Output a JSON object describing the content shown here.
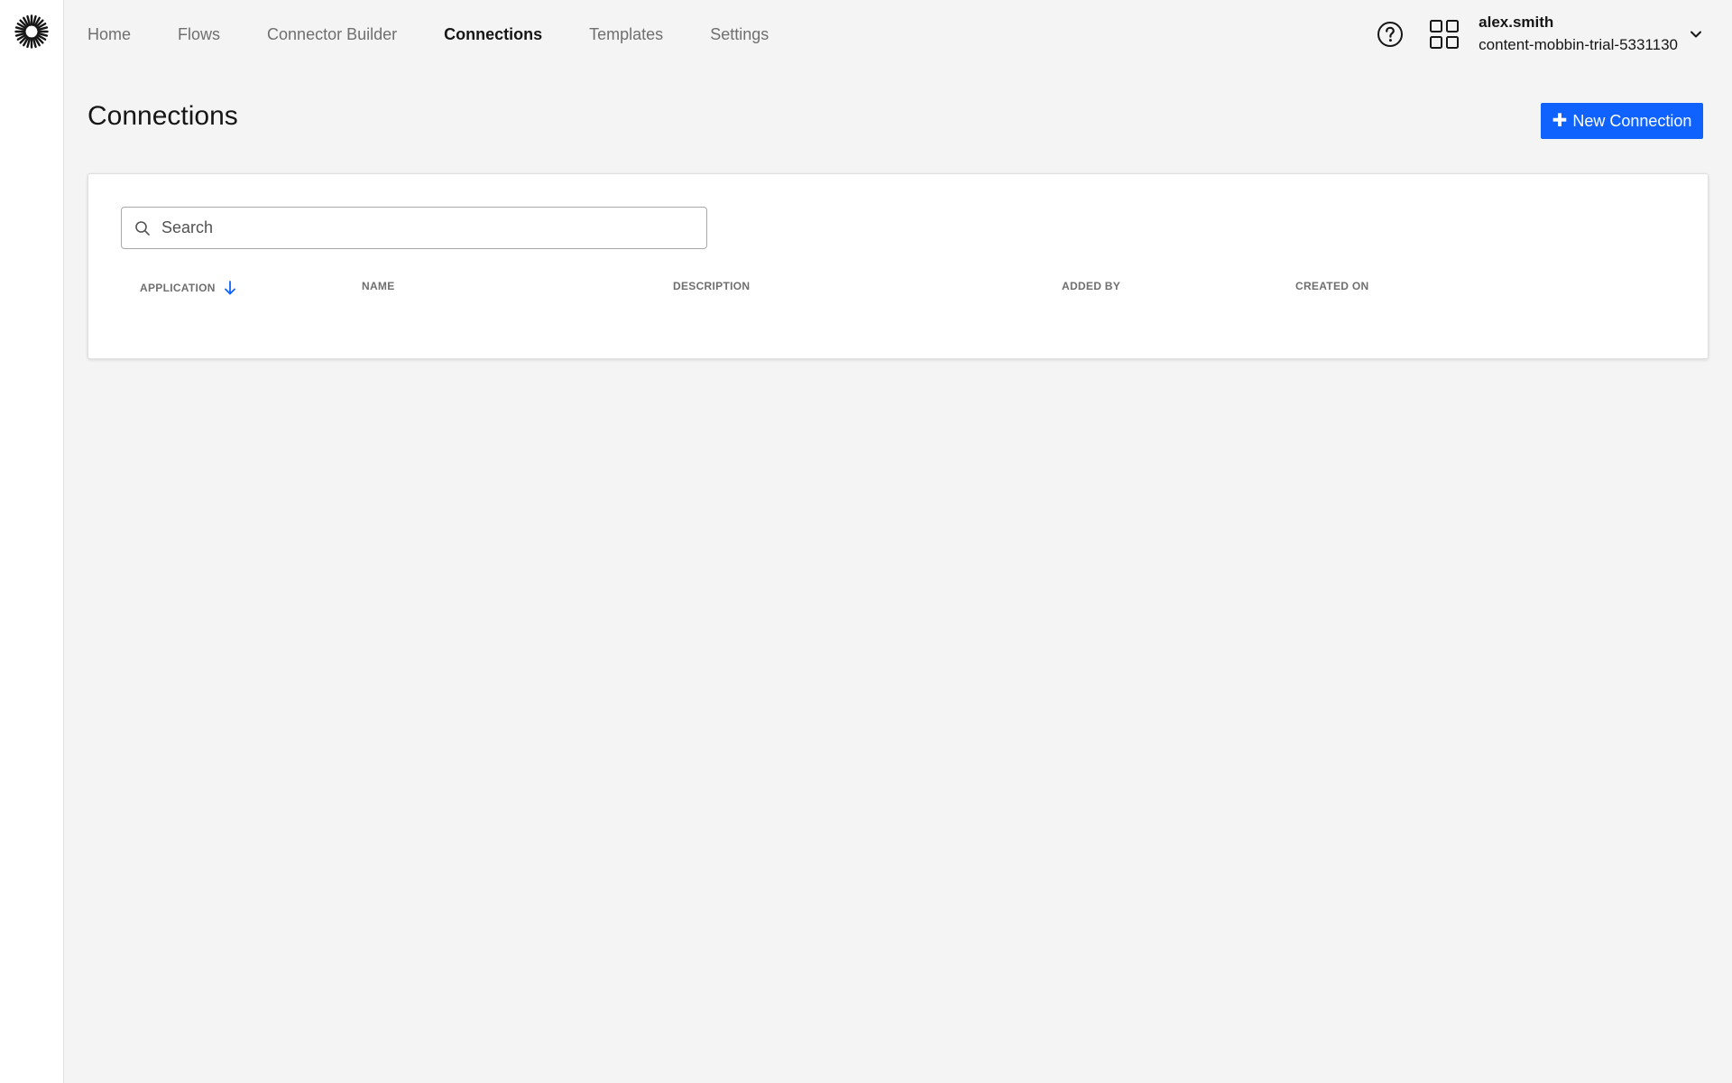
{
  "nav": {
    "items": [
      {
        "label": "Home",
        "active": false
      },
      {
        "label": "Flows",
        "active": false
      },
      {
        "label": "Connector Builder",
        "active": false
      },
      {
        "label": "Connections",
        "active": true
      },
      {
        "label": "Templates",
        "active": false
      },
      {
        "label": "Settings",
        "active": false
      }
    ]
  },
  "user": {
    "name": "alex.smith",
    "org": "content-mobbin-trial-5331130"
  },
  "page": {
    "title": "Connections",
    "new_button_label": "New Connection"
  },
  "search": {
    "placeholder": "Search",
    "value": ""
  },
  "table": {
    "columns": [
      {
        "label": "APPLICATION",
        "sorted": "descending"
      },
      {
        "label": "NAME"
      },
      {
        "label": "DESCRIPTION"
      },
      {
        "label": "ADDED BY"
      },
      {
        "label": "CREATED ON"
      }
    ],
    "rows": []
  },
  "colors": {
    "accent": "#0f62fe",
    "sort_icon": "#0f62fe",
    "background": "#f4f4f4"
  },
  "icons": {
    "logo": "sunburst-logo-icon",
    "help": "help-circle-icon",
    "apps": "app-grid-icon",
    "user_menu": "chevron-down-icon",
    "search": "search-icon",
    "sort": "arrow-down-icon",
    "add": "plus-icon"
  }
}
